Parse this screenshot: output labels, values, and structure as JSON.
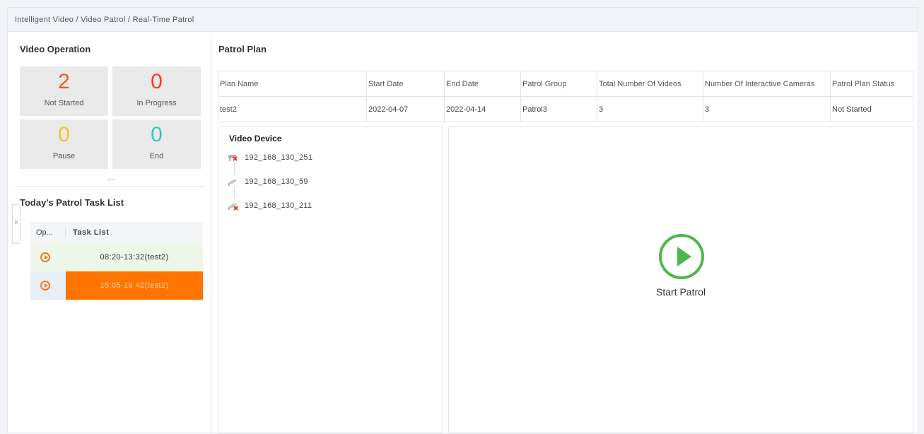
{
  "breadcrumb": "Intelligent Video / Video Patrol / Real-Time Patrol",
  "video_operation": {
    "title": "Video Operation",
    "stats": [
      {
        "value": "2",
        "label": "Not Started",
        "color": "#f05a23"
      },
      {
        "value": "0",
        "label": "In Progress",
        "color": "#ff3b1f"
      },
      {
        "value": "0",
        "label": "Pause",
        "color": "#f5c12a"
      },
      {
        "value": "0",
        "label": "End",
        "color": "#35c6c3"
      }
    ]
  },
  "task_list": {
    "title": "Today's Patrol Task List",
    "col_op": "Op...",
    "col_task": "Task List",
    "rows": [
      {
        "time": "08:20-13:32(test2)"
      },
      {
        "time": "15:05-19:42(test2)"
      }
    ]
  },
  "patrol_plan": {
    "title": "Patrol Plan",
    "headers": [
      "Plan Name",
      "Start Date",
      "End Date",
      "Patrol Group",
      "Total Number Of Videos",
      "Number Of Interactive Cameras",
      "Patrol Plan Status"
    ],
    "row": [
      "test2",
      "2022-04-07",
      "2022-04-14",
      "Patrol3",
      "3",
      "3",
      "Not Started"
    ]
  },
  "video_device": {
    "title": "Video Device",
    "devices": [
      "192_168_130_251",
      "192_168_130_59",
      "192_168_130_211"
    ]
  },
  "player": {
    "start_label": "Start Patrol"
  },
  "colors": {
    "accent_orange": "#ff7300",
    "play_green": "#4cb84c"
  },
  "icons": {
    "collapse": "«"
  }
}
